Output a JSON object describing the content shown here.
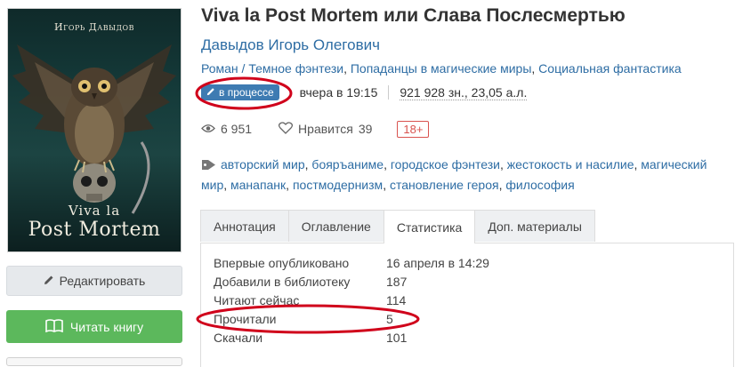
{
  "book": {
    "cover": {
      "author_line": "Игорь Давыдов",
      "title_line1": "Viva la",
      "title_line2": "Post Mortem"
    },
    "title": "Viva la Post Mortem или Слава Послесмертью",
    "author": "Давыдов Игорь Олегович",
    "genres": [
      "Роман / Темное фэнтези",
      "Попаданцы в магические миры",
      "Социальная фантастика"
    ],
    "status_badge": "в процессе",
    "updated": "вчера в 19:15",
    "size": "921 928 зн., 23,05 а.л.",
    "views": "6 951",
    "likes_label": "Нравится",
    "likes_count": "39",
    "age_rating": "18+",
    "tags": [
      "авторский мир",
      "бояръаниме",
      "городское фэнтези",
      "жестокость и насилие",
      "магический мир",
      "манапанк",
      "постмодернизм",
      "становление героя",
      "философия"
    ]
  },
  "buttons": {
    "edit": "Редактировать",
    "read": "Читать книгу"
  },
  "tabs": [
    "Аннотация",
    "Оглавление",
    "Статистика",
    "Доп. материалы"
  ],
  "active_tab": "Статистика",
  "stats": [
    {
      "label": "Впервые опубликовано",
      "value": "16 апреля в 14:29"
    },
    {
      "label": "Добавили в библиотеку",
      "value": "187"
    },
    {
      "label": "Читают сейчас",
      "value": "114"
    },
    {
      "label": "Прочитали",
      "value": "5"
    },
    {
      "label": "Скачали",
      "value": "101"
    }
  ],
  "colors": {
    "link": "#2e6da4",
    "badge": "#3e7bb2",
    "read_button": "#5cb85c",
    "age_rating": "#d9534f",
    "annotation": "#d0021b"
  }
}
